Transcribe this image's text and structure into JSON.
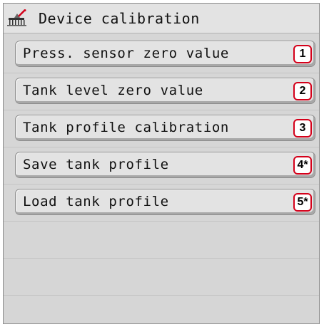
{
  "header": {
    "title": "Device calibration",
    "icon": "sprayer-calibration-icon"
  },
  "menu": {
    "items": [
      {
        "label": "Press. sensor zero value",
        "badge": "1"
      },
      {
        "label": "Tank level zero value",
        "badge": "2"
      },
      {
        "label": "Tank profile calibration",
        "badge": "3"
      },
      {
        "label": "Save tank profile",
        "badge": "4*"
      },
      {
        "label": "Load tank profile",
        "badge": "5*"
      }
    ]
  },
  "colors": {
    "badge_border": "#d4001a",
    "background": "#d6d6d6",
    "button": "#e3e3e3"
  }
}
